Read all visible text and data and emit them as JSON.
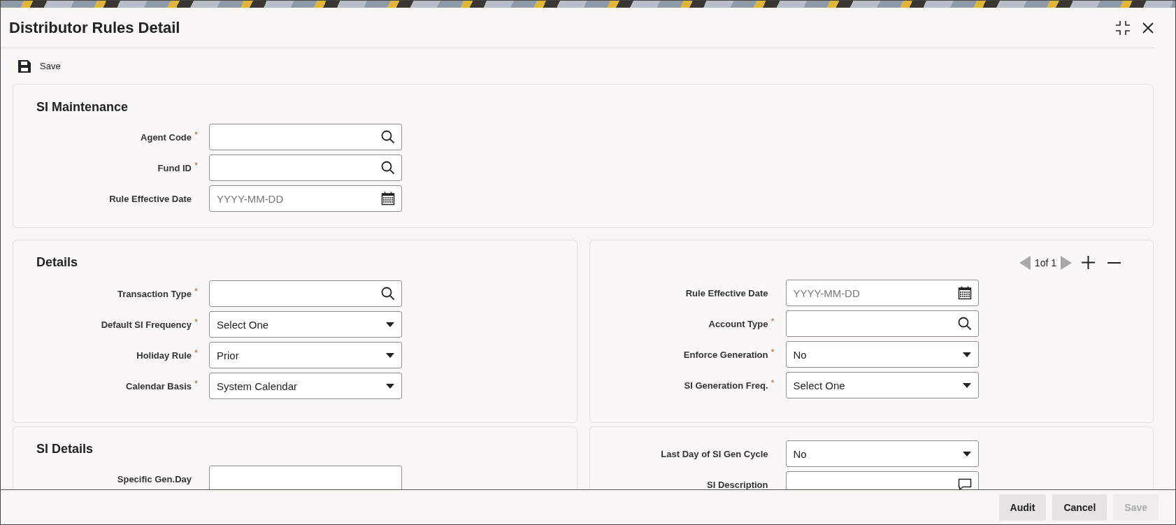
{
  "window": {
    "title": "Distributor Rules Detail"
  },
  "toolbar": [
    {
      "label": "Save"
    }
  ],
  "si_maintenance": {
    "title": "SI Maintenance",
    "fields": [
      {
        "label": "Agent Code",
        "required_mark": "*",
        "kind": "lookup"
      },
      {
        "label": "Fund ID",
        "required_mark": "*",
        "kind": "lookup"
      },
      {
        "label": "Rule Effective Date",
        "kind": "date",
        "placeholder": "YYYY-MM-DD"
      }
    ]
  },
  "details": {
    "title": "Details",
    "fields": [
      {
        "label": "Transaction Type",
        "required_mark": "*",
        "kind": "lookup"
      },
      {
        "label": "Default SI Frequency",
        "required_mark": "*",
        "kind": "select",
        "value": "Select One"
      },
      {
        "label": "Holiday Rule",
        "required_mark": "*",
        "kind": "select",
        "value": "Prior"
      },
      {
        "label": "Calendar Basis",
        "required_mark": "*",
        "kind": "select",
        "value": "System Calendar"
      }
    ]
  },
  "details_records": {
    "pager": {
      "text": "1of 1"
    },
    "fields": [
      {
        "label": "Rule Effective Date",
        "kind": "date",
        "placeholder": "YYYY-MM-DD"
      },
      {
        "label": "Account Type",
        "required_mark": "*",
        "kind": "lookup"
      },
      {
        "label": "Enforce Generation",
        "required_mark": "*",
        "kind": "select",
        "value": "No"
      },
      {
        "label": "SI Generation Freq.",
        "required_mark": "*",
        "kind": "select",
        "value": "Select One"
      }
    ]
  },
  "si_details": {
    "title": "SI Details",
    "fields": [
      {
        "label": "Specific Gen.Day",
        "kind": "text"
      }
    ]
  },
  "si_details_right": {
    "fields": [
      {
        "label": "Last Day of SI Gen Cycle",
        "kind": "select",
        "value": "No"
      },
      {
        "label": "SI Description",
        "kind": "textarea"
      }
    ]
  },
  "footer_buttons": [
    {
      "label": "Audit",
      "disabled": false
    },
    {
      "label": "Cancel",
      "disabled": false
    },
    {
      "label": "Save",
      "disabled": true
    }
  ]
}
